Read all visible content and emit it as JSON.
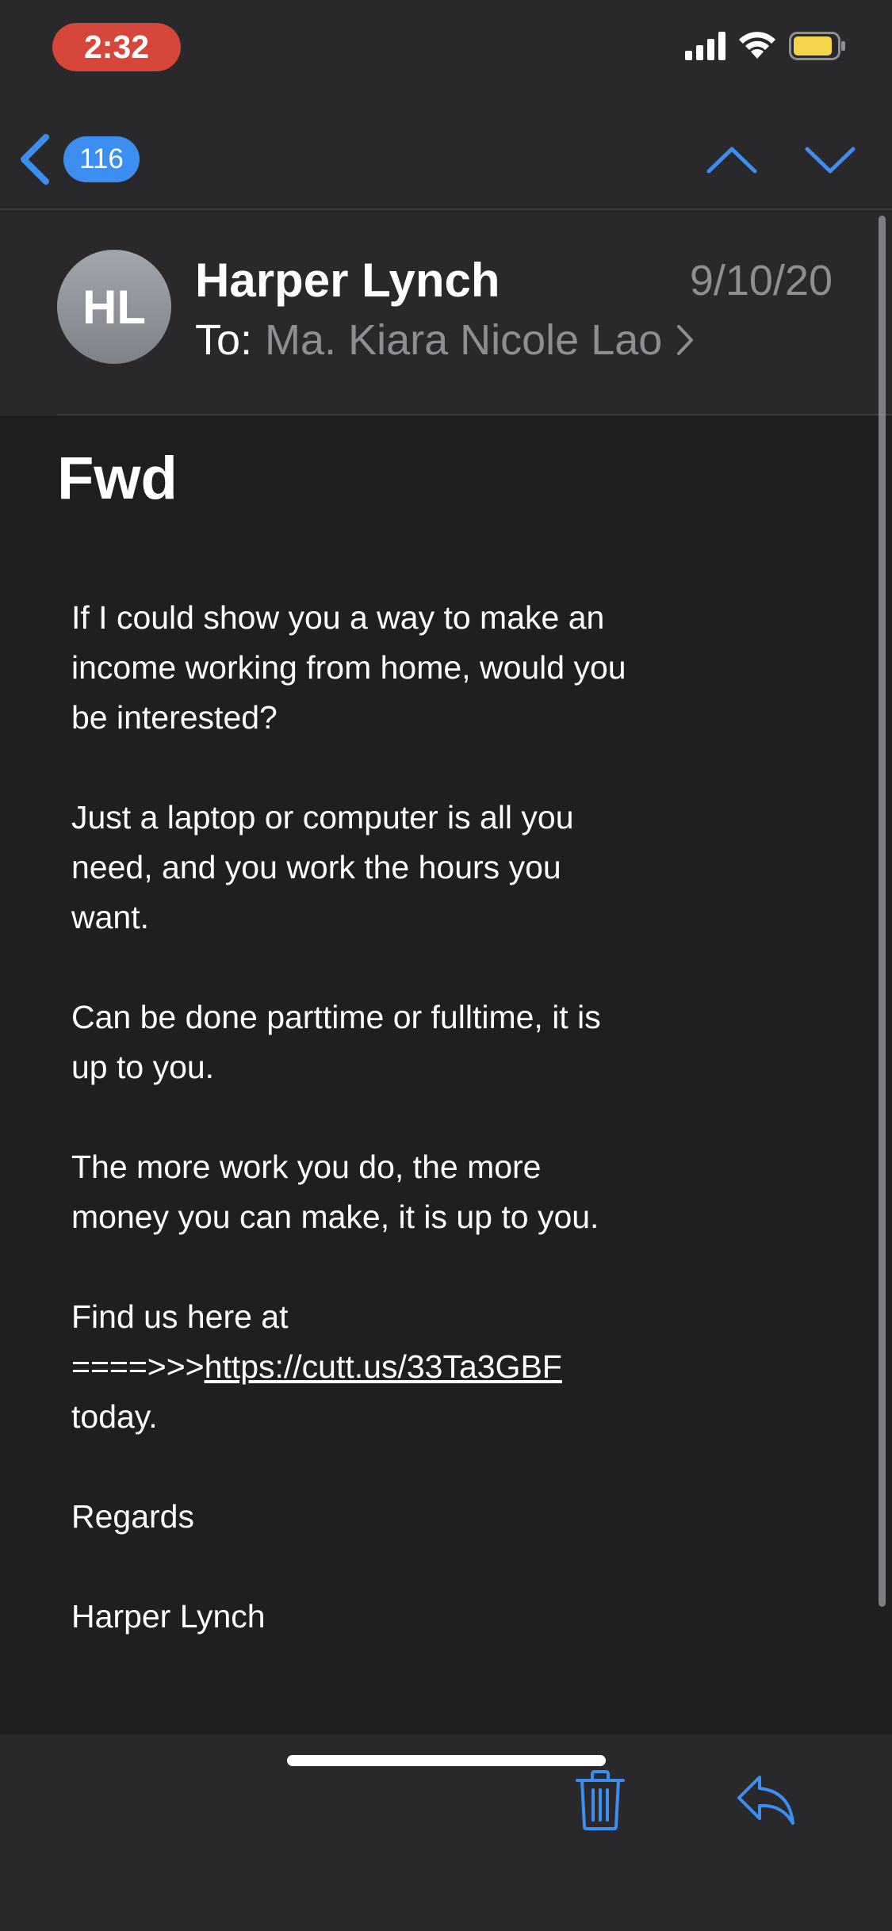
{
  "status_bar": {
    "time": "2:32",
    "icons": [
      "signal-icon",
      "wifi-icon",
      "battery-icon"
    ],
    "battery_color": "#f5d54a",
    "time_pill_color": "#d7463b"
  },
  "nav": {
    "unread_count": "116",
    "back_icon": "chevron-left-icon",
    "prev_icon": "chevron-up-icon",
    "next_icon": "chevron-down-icon",
    "accent_color": "#3c8ff0"
  },
  "email": {
    "avatar_initials": "HL",
    "sender": "Harper Lynch",
    "date": "9/10/20",
    "to_label": "To:",
    "recipient": "Ma. Kiara Nicole Lao",
    "subject": "Fwd",
    "body": {
      "p1": "If I could show you a way to make an income working from home, would you be interested?",
      "p2": "Just a laptop or computer is all you need, and you work the hours you want.",
      "p3": "Can be done parttime or fulltime, it is up to you.",
      "p4": "The more work you do, the more money you can make, it is up to you.",
      "p5_prefix": "Find us here at ====>>>",
      "p5_link": "https://cutt.us/33Ta3GBF",
      "p5_suffix": " today.",
      "p6": "Regards",
      "p7": "Harper Lynch"
    }
  },
  "toolbar": {
    "icons": [
      "trash-icon",
      "reply-icon"
    ]
  }
}
